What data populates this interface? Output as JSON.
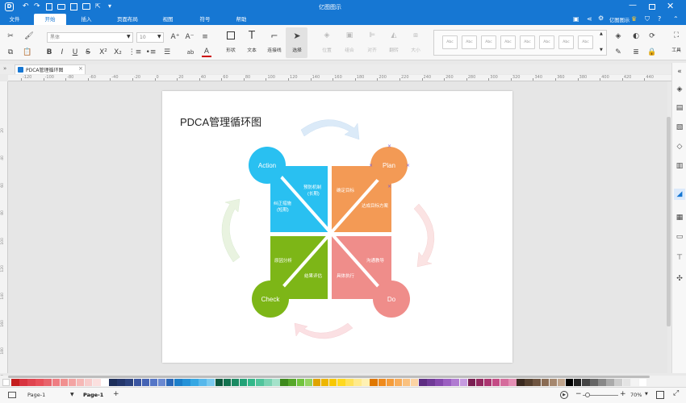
{
  "app": {
    "title": "亿图图示",
    "user_label": "亿图图示"
  },
  "menu": {
    "tabs": [
      {
        "label": "文件"
      },
      {
        "label": "开始"
      },
      {
        "label": "插入"
      },
      {
        "label": "页面布局"
      },
      {
        "label": "视图"
      },
      {
        "label": "符号"
      },
      {
        "label": "帮助"
      }
    ]
  },
  "ribbon": {
    "font_family": "黑体",
    "font_size": "10",
    "shape_label": "形状",
    "text_label": "文本",
    "connector_label": "连接线",
    "select_label": "选择",
    "position_label": "位置",
    "group_label": "组合",
    "align_label": "对齐",
    "flip_label": "翻转",
    "size_label": "大小",
    "style_sample": "Abc",
    "tools_label": "工具"
  },
  "doc": {
    "tab_title": "PDCA管理循环图"
  },
  "ruler": {
    "h": [
      "-120",
      "-100",
      "-80",
      "-60",
      "-40",
      "-20",
      "0",
      "20",
      "40",
      "60",
      "80",
      "100",
      "120",
      "140",
      "160",
      "180",
      "200",
      "220",
      "240",
      "260",
      "280",
      "300",
      "320",
      "340",
      "360",
      "380",
      "400",
      "420",
      "440"
    ],
    "v": [
      "20",
      "40",
      "60",
      "80",
      "100",
      "120",
      "140",
      "160",
      "180",
      "200"
    ]
  },
  "diagram": {
    "title": "PDCA管理循环图",
    "quadrants": {
      "action": {
        "circle": "Action",
        "text_a": "预防机制",
        "text_a2": "(长期)",
        "text_b": "纠正措施",
        "text_b2": "(短期)",
        "color": "#29c0f1"
      },
      "plan": {
        "circle": "Plan",
        "text_a": "确定目标",
        "text_b": "达成目标方案",
        "color": "#f39a55"
      },
      "check": {
        "circle": "Check",
        "text_a": "原因分析",
        "text_b": "结果评估",
        "color": "#7db617"
      },
      "do": {
        "circle": "Do",
        "text_a": "沟通教导",
        "text_b": "具体执行",
        "color": "#ef8d8a"
      }
    }
  },
  "status": {
    "page_select": "Page-1",
    "page_tab": "Page-1",
    "add": "+",
    "zoom": "70%"
  },
  "palette_colors": [
    "#c41e1e",
    "#d8343f",
    "#e0444f",
    "#e8505a",
    "#e8646c",
    "#ef7d82",
    "#f1908f",
    "#f3a4a3",
    "#f6b8b6",
    "#f8cccb",
    "#fbe0df",
    "#ffffff",
    "#1d2e5a",
    "#24366b",
    "#2c427e",
    "#3a55a1",
    "#4563b4",
    "#5576c7",
    "#6a89d1",
    "#2a67b8",
    "#1c7ec9",
    "#2592d8",
    "#35a7e3",
    "#57b8eb",
    "#7acaef",
    "#0d5a3f",
    "#12724f",
    "#1a8a62",
    "#23a277",
    "#33b88a",
    "#51c49c",
    "#7bd3b3",
    "#a4e2ca",
    "#3d8a1c",
    "#56a72a",
    "#72c43e",
    "#94d35f",
    "#e0a400",
    "#edb600",
    "#f8c800",
    "#ffd91f",
    "#ffe25a",
    "#ffea8c",
    "#fff1b3",
    "#e07800",
    "#ef8a1c",
    "#f59c3a",
    "#f8ad5a",
    "#fac17f",
    "#fcd4a4",
    "#5e2d82",
    "#703a97",
    "#8549ad",
    "#9b5fc1",
    "#b07bd1",
    "#c69be0",
    "#7a1f52",
    "#93285f",
    "#ab3570",
    "#c44b85",
    "#d56c9c",
    "#e48fb4",
    "#3b2a20",
    "#55402f",
    "#6f5541",
    "#8a6c54",
    "#a5876e",
    "#bfa48c",
    "#000000",
    "#222222",
    "#444444",
    "#666666",
    "#888888",
    "#aaaaaa",
    "#cccccc",
    "#e4e4e4",
    "#f4f4f4",
    "#ffffff"
  ]
}
